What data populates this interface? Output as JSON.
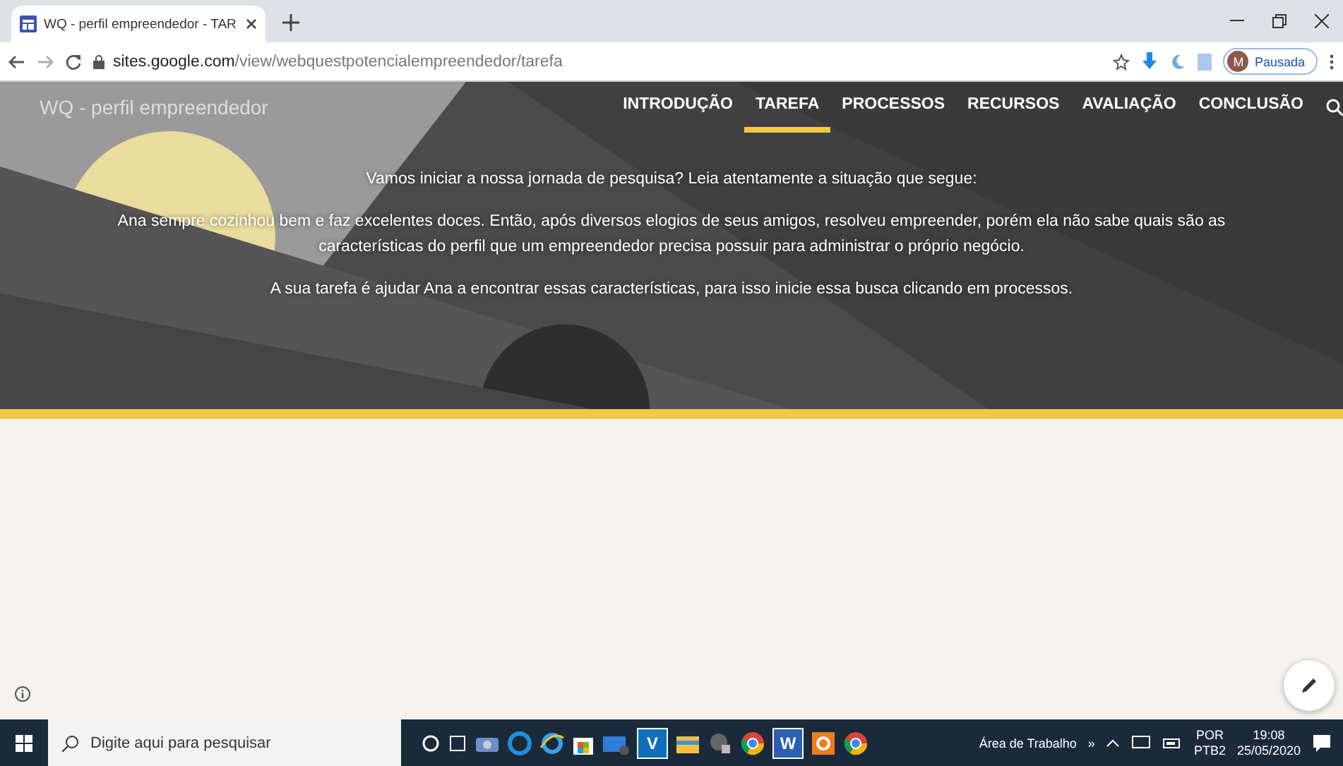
{
  "browser": {
    "tab": {
      "title": "WQ - perfil empreendedor - TAR",
      "selected": true
    },
    "address": {
      "host": "sites.google.com",
      "path": "/view/webquestpotencialempreendedor/tarefa"
    },
    "profile": {
      "initial": "M",
      "status": "Pausada"
    }
  },
  "site": {
    "title": "WQ - perfil empreendedor",
    "nav": [
      {
        "label": "INTRODUÇÃO",
        "selected": false
      },
      {
        "label": "TAREFA",
        "selected": true
      },
      {
        "label": "PROCESSOS",
        "selected": false
      },
      {
        "label": "RECURSOS",
        "selected": false
      },
      {
        "label": "AVALIAÇÃO",
        "selected": false
      },
      {
        "label": "CONCLUSÃO",
        "selected": false
      }
    ],
    "paragraphs": [
      "Vamos iniciar a nossa jornada de pesquisa? Leia atentamente a situação que segue:",
      "Ana sempre cozinhou bem e faz excelentes doces. Então, após diversos elogios de seus amigos, resolveu empreender, porém ela não sabe quais são as características do perfil que um empreendedor precisa possuir para administrar o próprio negócio.",
      "A sua tarefa é ajudar Ana a encontrar essas características, para isso inicie essa busca clicando em processos."
    ]
  },
  "taskbar": {
    "search": {
      "placeholder": "Digite aqui para pesquisar"
    },
    "apps": [
      {
        "kind": "cortana"
      },
      {
        "kind": "taskview"
      },
      {
        "kind": "camera"
      },
      {
        "kind": "edge"
      },
      {
        "kind": "ie"
      },
      {
        "kind": "store"
      },
      {
        "kind": "mail"
      },
      {
        "kind": "letter",
        "label": "V",
        "color": "#0f6fb8"
      },
      {
        "kind": "folder"
      },
      {
        "kind": "media"
      },
      {
        "kind": "chrome"
      },
      {
        "kind": "letter",
        "label": "W",
        "color": "#2b5fb3"
      },
      {
        "kind": "orange"
      },
      {
        "kind": "chrome"
      }
    ],
    "toolbar": "Área de Trabalho",
    "chevron": "»",
    "language": "POR",
    "layout": "PTB2",
    "time": "19:08",
    "date": "25/05/2020"
  }
}
